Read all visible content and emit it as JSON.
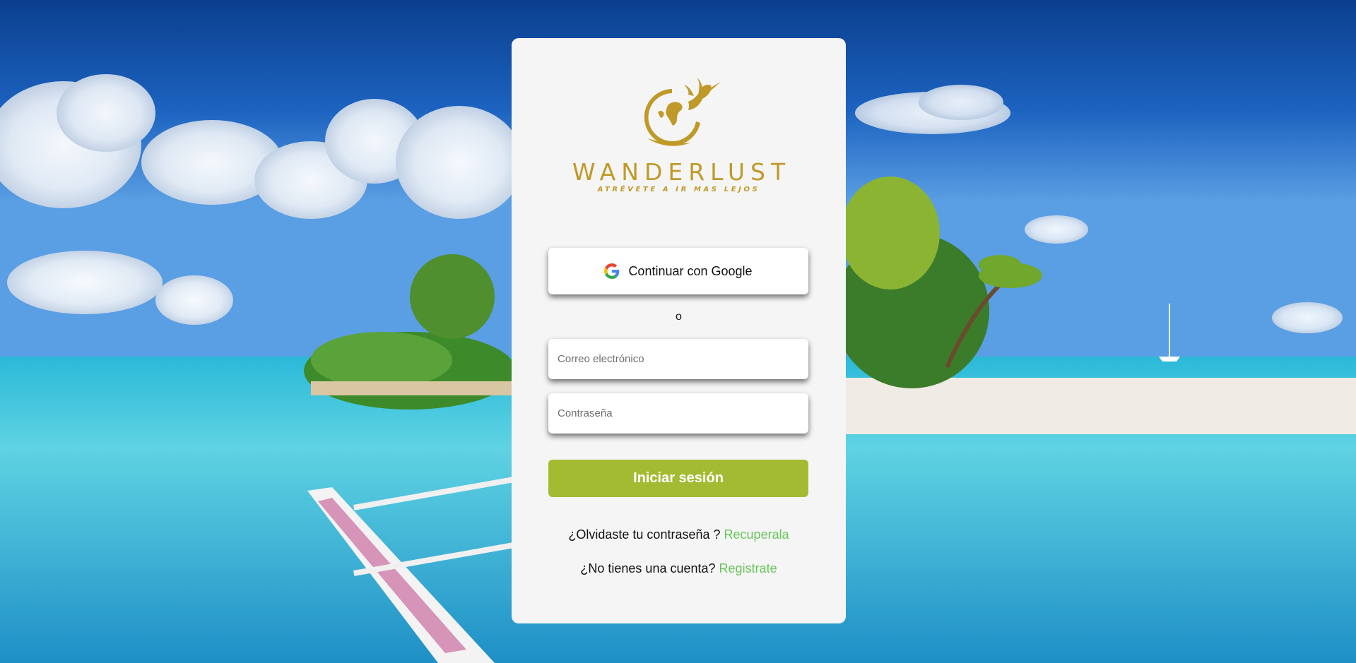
{
  "brand": {
    "name": "WANDERLUST",
    "tagline": "ATRÉVETE A IR MAS LEJOS",
    "color": "#c09a28"
  },
  "login": {
    "google_label": "Continuar con Google",
    "or_text": "o",
    "email_placeholder": "Correo electrónico",
    "password_placeholder": "Contraseña",
    "submit_label": "Iniciar sesión",
    "submit_color": "#a3bb33",
    "forgot_text": "¿Olvidaste tu contraseña ?",
    "forgot_link": "Recuperala",
    "signup_text": "¿No tienes una cuenta?",
    "signup_link": "Registrate",
    "link_color": "#68c45a"
  },
  "icons": {
    "google": "google-icon",
    "logo": "globe-hummingbird-logo",
    "background": "tropical-beach-photo"
  }
}
